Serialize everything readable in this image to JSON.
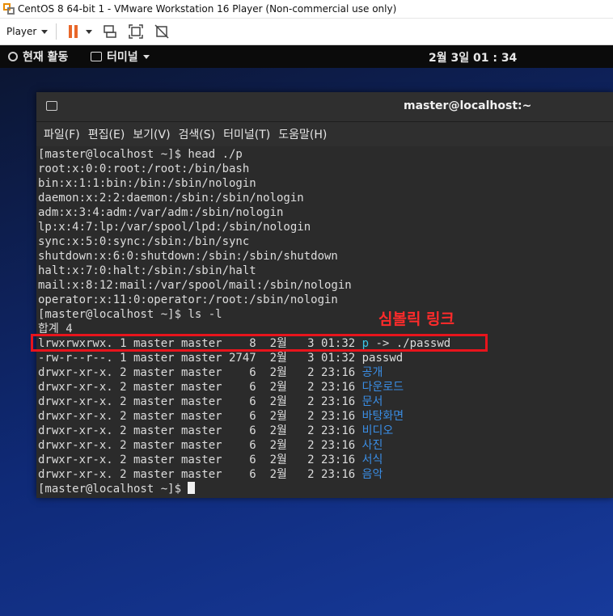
{
  "window": {
    "title": "CentOS 8 64-bit 1 - VMware Workstation 16 Player (Non-commercial use only)"
  },
  "toolbar": {
    "player_label": "Player",
    "icons": [
      "pause-icon",
      "send-keys-icon",
      "fit-guest-icon",
      "unity-icon"
    ]
  },
  "gnome": {
    "activities": "현재 활동",
    "app": "터미널",
    "clock": "2월 3일 01 : 34"
  },
  "terminal": {
    "title": "master@localhost:~",
    "menu": [
      "파일(F)",
      "편집(E)",
      "보기(V)",
      "검색(S)",
      "터미널(T)",
      "도움말(H)"
    ],
    "lines": [
      "[master@localhost ~]$ head ./p",
      "root:x:0:0:root:/root:/bin/bash",
      "bin:x:1:1:bin:/bin:/sbin/nologin",
      "daemon:x:2:2:daemon:/sbin:/sbin/nologin",
      "adm:x:3:4:adm:/var/adm:/sbin/nologin",
      "lp:x:4:7:lp:/var/spool/lpd:/sbin/nologin",
      "sync:x:5:0:sync:/sbin:/bin/sync",
      "shutdown:x:6:0:shutdown:/sbin:/sbin/shutdown",
      "halt:x:7:0:halt:/sbin:/sbin/halt",
      "mail:x:8:12:mail:/var/spool/mail:/sbin/nologin",
      "operator:x:11:0:operator:/root:/sbin/nologin",
      "[master@localhost ~]$ ls -l",
      "합계 4"
    ],
    "ls": [
      {
        "meta": "lrwxrwxrwx. 1 master master    8  2월   3 01:32 ",
        "name": "p -> ./passwd",
        "color": "link"
      },
      {
        "meta": "-rw-r--r--. 1 master master 2747  2월   3 01:32 ",
        "name": "passwd",
        "color": "plain"
      },
      {
        "meta": "drwxr-xr-x. 2 master master    6  2월   2 23:16 ",
        "name": "공개",
        "color": "dir"
      },
      {
        "meta": "drwxr-xr-x. 2 master master    6  2월   2 23:16 ",
        "name": "다운로드",
        "color": "dir"
      },
      {
        "meta": "drwxr-xr-x. 2 master master    6  2월   2 23:16 ",
        "name": "문서",
        "color": "dir"
      },
      {
        "meta": "drwxr-xr-x. 2 master master    6  2월   2 23:16 ",
        "name": "바탕화면",
        "color": "dir"
      },
      {
        "meta": "drwxr-xr-x. 2 master master    6  2월   2 23:16 ",
        "name": "비디오",
        "color": "dir"
      },
      {
        "meta": "drwxr-xr-x. 2 master master    6  2월   2 23:16 ",
        "name": "사진",
        "color": "dir"
      },
      {
        "meta": "drwxr-xr-x. 2 master master    6  2월   2 23:16 ",
        "name": "서식",
        "color": "dir"
      },
      {
        "meta": "drwxr-xr-x. 2 master master    6  2월   2 23:16 ",
        "name": "음악",
        "color": "dir"
      }
    ],
    "prompt": "[master@localhost ~]$ "
  },
  "annotation": {
    "label": "심볼릭 링크",
    "color": "#e8141c"
  }
}
